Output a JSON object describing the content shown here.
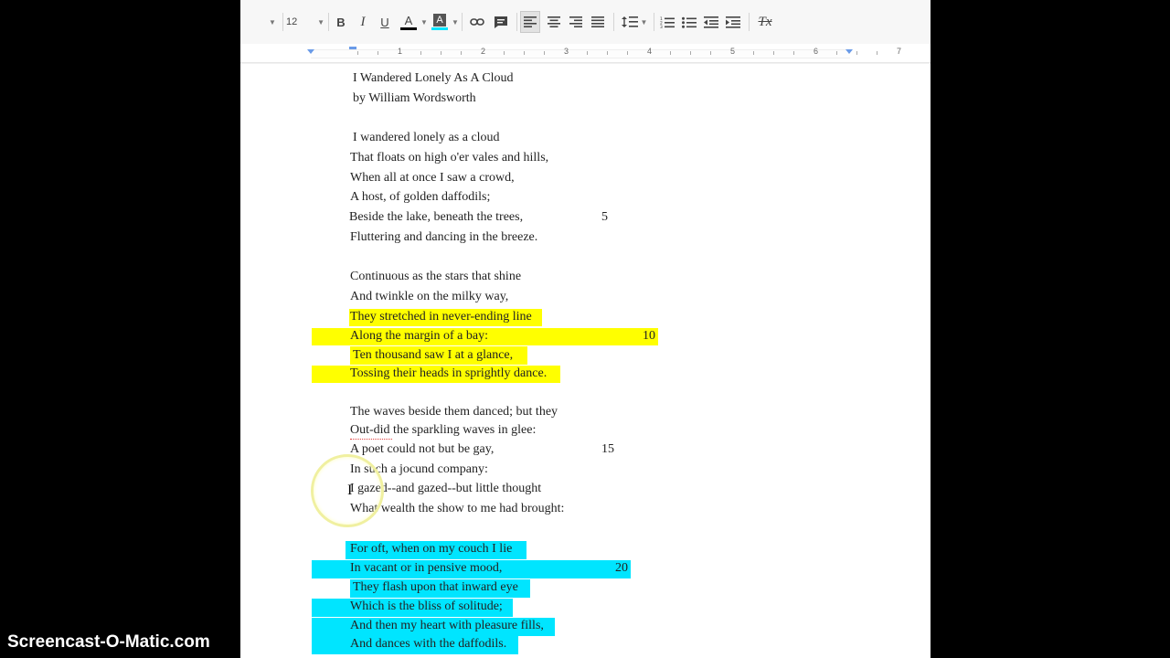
{
  "toolbar": {
    "font_size": "12",
    "bold_label": "B",
    "italic_label": "I",
    "underline_label": "U",
    "text_color_label": "A",
    "highlight_label": "A",
    "text_color_bar": "#000000",
    "highlight_bar": "#00e5ff",
    "clear_format_label": "Tx"
  },
  "ruler": {
    "numbers": [
      "1",
      "2",
      "3",
      "4",
      "5",
      "6",
      "7"
    ]
  },
  "document": {
    "title": "I Wandered Lonely As A Cloud",
    "author": "by William Wordsworth",
    "lines": [
      "I wandered lonely as a cloud",
      "That floats on high o'er vales and hills,",
      "When all at once I saw a crowd,",
      "A host, of golden daffodils;",
      "Beside the lake, beneath the trees,",
      "Fluttering and dancing in the breeze.",
      "Continuous as the stars that shine",
      "And twinkle on the milky way,",
      "They stretched in never-ending line",
      "Along the margin of a bay:",
      "Ten thousand saw I at a glance,",
      "Tossing their heads in sprightly dance.",
      "The waves beside them danced; but they",
      "Out-did the sparkling waves in glee:",
      "A poet could not but be gay,",
      "In such a jocund company:",
      "I gazed--and gazed--but little thought",
      "What wealth the show to me had brought:",
      "For oft, when on my couch I lie",
      "In vacant or in pensive mood,",
      "They flash upon that inward eye",
      "Which is the bliss of solitude;",
      "And then my heart with pleasure fills,",
      "And dances with the daffodils."
    ],
    "line_numbers": {
      "n5": "5",
      "n10": "10",
      "n15": "15",
      "n20": "20"
    },
    "highlight_yellow": "#ffff00",
    "highlight_cyan": "#00e5ff"
  },
  "watermark": "Screencast-O-Matic.com"
}
